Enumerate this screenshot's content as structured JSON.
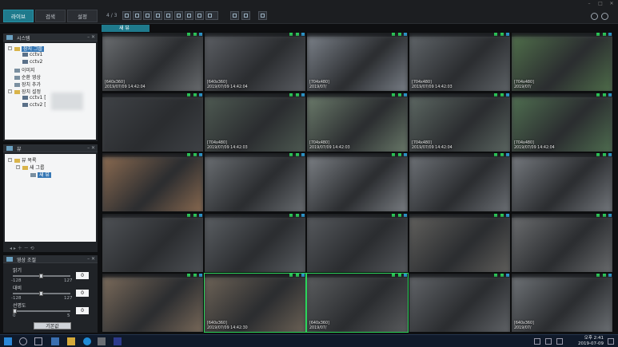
{
  "tabs": [
    {
      "label": "라이브",
      "active": true
    },
    {
      "label": "검색",
      "active": false
    },
    {
      "label": "설정",
      "active": false
    }
  ],
  "toolbar": {
    "page_indicator": "4 / 3"
  },
  "system_panel": {
    "title": "시스템",
    "tree": [
      {
        "label": "장치 그룹",
        "level": 1,
        "icon": "folder",
        "selected": true
      },
      {
        "label": "cctv1",
        "level": 2,
        "icon": "camera"
      },
      {
        "label": "cctv2",
        "level": 2,
        "icon": "camera"
      },
      {
        "label": "이미지",
        "level": 1,
        "icon": "image"
      },
      {
        "label": "순환 영상",
        "level": 1,
        "icon": "rotation"
      },
      {
        "label": "장치 추가",
        "level": 1,
        "icon": "add"
      },
      {
        "label": "장치 설정",
        "level": 1,
        "icon": "folder"
      },
      {
        "label": "cctv1 [",
        "level": 2,
        "icon": "camera"
      },
      {
        "label": "cctv2 [",
        "level": 2,
        "icon": "camera"
      }
    ]
  },
  "view_panel": {
    "title": "뷰",
    "tree": [
      {
        "label": "뷰 목록",
        "level": 1,
        "icon": "folder"
      },
      {
        "label": "새 그룹",
        "level": 2,
        "icon": "folder"
      },
      {
        "label": "새 뷰",
        "level": 3,
        "icon": "view",
        "selected": true
      }
    ]
  },
  "adjust_panel": {
    "title": "영상 조절",
    "sliders": [
      {
        "label": "밝기",
        "value": "0",
        "min": "-128",
        "max": "127",
        "level": 0.5
      },
      {
        "label": "대비",
        "value": "0",
        "min": "-128",
        "max": "127",
        "level": 0.5
      },
      {
        "label": "선명도",
        "value": "0",
        "min": "0",
        "max": "5",
        "level": 0
      }
    ],
    "reset_label": "기본값"
  },
  "view_tab": "새 뷰",
  "cells": [
    {
      "res": "[640x360]",
      "ts": "2019/07/09 14:42:04",
      "color": "#6a6d70",
      "hl": false
    },
    {
      "res": "[640x360]",
      "ts": "2019/07/09 14:42:04",
      "color": "#5b5e63",
      "hl": false
    },
    {
      "res": "[704x480]",
      "ts": "2019/07/",
      "color": "#7a8088",
      "hl": false
    },
    {
      "res": "[704x480]",
      "ts": "2019/07/09 14:42:03",
      "color": "#5f6468",
      "hl": false
    },
    {
      "res": "[704x480]",
      "ts": "2019/07/",
      "color": "#4f6e4a",
      "hl": false
    },
    {
      "res": "",
      "ts": "",
      "color": "#3f4246",
      "hl": false
    },
    {
      "res": "[704x480]",
      "ts": "2019/07/09 14:42:03",
      "color": "#4e5a52",
      "hl": false
    },
    {
      "res": "[704x480]",
      "ts": "2019/07/09 14:42:03",
      "color": "#6a7a6a",
      "hl": false
    },
    {
      "res": "[704x480]",
      "ts": "2019/07/09 14:42:04",
      "color": "#5c6762",
      "hl": false
    },
    {
      "res": "[704x480]",
      "ts": "2019/07/09 14:42:04",
      "color": "#4f6e50",
      "hl": false
    },
    {
      "res": "",
      "ts": "",
      "color": "#8a6a50",
      "hl": false
    },
    {
      "res": "",
      "ts": "",
      "color": "#6a6e72",
      "hl": false
    },
    {
      "res": "",
      "ts": "",
      "color": "#7b7f84",
      "hl": false
    },
    {
      "res": "",
      "ts": "",
      "color": "#6d7176",
      "hl": false
    },
    {
      "res": "",
      "ts": "",
      "color": "#75797e",
      "hl": false
    },
    {
      "res": "",
      "ts": "",
      "color": "#4e5155",
      "hl": false
    },
    {
      "res": "",
      "ts": "",
      "color": "#5a5e62",
      "hl": false
    },
    {
      "res": "",
      "ts": "",
      "color": "#56595d",
      "hl": false
    },
    {
      "res": "",
      "ts": "",
      "color": "#605f5c",
      "hl": false
    },
    {
      "res": "",
      "ts": "",
      "color": "#6a6c6e",
      "hl": false
    },
    {
      "res": "",
      "ts": "",
      "color": "#7a6a5a",
      "hl": false
    },
    {
      "res": "[640x360]",
      "ts": "2019/07/09 14:42:30",
      "color": "#6c6256",
      "hl": true
    },
    {
      "res": "[640x360]",
      "ts": "2019/07/",
      "color": "#5a5c5e",
      "hl": true
    },
    {
      "res": "",
      "ts": "",
      "color": "#616468",
      "hl": false
    },
    {
      "res": "[640x360]",
      "ts": "2019/07/",
      "color": "#6e7276",
      "hl": false
    }
  ],
  "clock": {
    "time": "오후 2:41",
    "date": "2019-07-09"
  },
  "colors": {
    "accent": "#1f7a8c",
    "highlight": "#2bd45a"
  }
}
